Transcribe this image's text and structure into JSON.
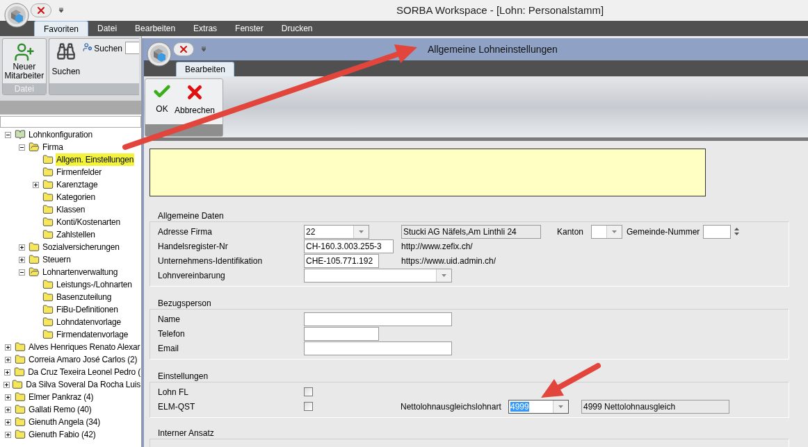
{
  "window": {
    "title": "SORBA Workspace - [Lohn: Personalstamm]"
  },
  "menu_tabs": [
    {
      "label": "Favoriten",
      "selected": true
    },
    {
      "label": "Datei",
      "selected": false
    },
    {
      "label": "Bearbeiten",
      "selected": false
    },
    {
      "label": "Extras",
      "selected": false
    },
    {
      "label": "Fenster",
      "selected": false
    },
    {
      "label": "Drucken",
      "selected": false
    }
  ],
  "ribbon": {
    "new_employee_button": "Neuer Mitarbeiter",
    "file_group_caption": "Datei",
    "search_button": "Suchen",
    "search_small_button": "Suchen"
  },
  "sidebar": {
    "tree": [
      {
        "label": "Lohnkonfiguration",
        "kind": "book",
        "expanded": true,
        "selected": false,
        "children": [
          {
            "label": "Firma",
            "kind": "folder",
            "expanded": true,
            "selected": false,
            "children": [
              {
                "label": "Allgem. Einstellungen",
                "kind": "folder",
                "selected": true
              },
              {
                "label": "Firmenfelder",
                "kind": "folder",
                "selected": false
              },
              {
                "label": "Karenztage",
                "kind": "folder",
                "expanded": false,
                "selected": false
              },
              {
                "label": "Kategorien",
                "kind": "folder",
                "selected": false
              },
              {
                "label": "Klassen",
                "kind": "folder",
                "selected": false
              },
              {
                "label": "Konti/Kostenarten",
                "kind": "folder",
                "selected": false
              },
              {
                "label": "Zahlstellen",
                "kind": "folder",
                "selected": false
              }
            ]
          },
          {
            "label": "Sozialversicherungen",
            "kind": "folder",
            "expanded": false,
            "selected": false
          },
          {
            "label": "Steuern",
            "kind": "folder",
            "expanded": false,
            "selected": false
          },
          {
            "label": "Lohnartenverwaltung",
            "kind": "folder",
            "expanded": true,
            "selected": false,
            "children": [
              {
                "label": "Leistungs-/Lohnarten",
                "kind": "folder",
                "selected": false
              },
              {
                "label": "Basenzuteilung",
                "kind": "folder",
                "selected": false
              },
              {
                "label": "FiBu-Definitionen",
                "kind": "folder",
                "selected": false
              },
              {
                "label": "Lohndatenvorlage",
                "kind": "folder",
                "selected": false
              },
              {
                "label": "Firmendatenvorlage",
                "kind": "folder",
                "selected": false
              }
            ]
          }
        ]
      },
      {
        "label": "Alves Henriques Renato Alexar",
        "kind": "folder",
        "expanded": false,
        "selected": false
      },
      {
        "label": "Correia Amaro José Carlos (2)",
        "kind": "folder",
        "expanded": false,
        "selected": false
      },
      {
        "label": "Da Cruz Texeira Leonel Pedro (",
        "kind": "folder",
        "expanded": false,
        "selected": false
      },
      {
        "label": "Da Silva Soveral Da Rocha Luis",
        "kind": "folder",
        "expanded": false,
        "selected": false
      },
      {
        "label": "Elmer Pankraz (4)",
        "kind": "folder",
        "expanded": false,
        "selected": false
      },
      {
        "label": "Gallati Remo (40)",
        "kind": "folder",
        "expanded": false,
        "selected": false
      },
      {
        "label": "Gienuth Angela (34)",
        "kind": "folder",
        "expanded": false,
        "selected": false
      },
      {
        "label": "Gienuth Fabio (42)",
        "kind": "folder",
        "expanded": false,
        "selected": false
      }
    ]
  },
  "dialog": {
    "title": "Allgemeine Lohneinstellungen",
    "tabs": [
      {
        "label": "Bearbeiten",
        "selected": true
      }
    ],
    "buttons": [
      {
        "label": "OK",
        "kind": "ok"
      },
      {
        "label": "Abbrechen",
        "kind": "cancel"
      }
    ],
    "general": {
      "title": "Allgemeine Daten",
      "address_label": "Adresse Firma",
      "address_value": "22",
      "address_text": "Stucki AG Näfels,Am Linthli 24",
      "canton_label": "Kanton",
      "municipality_label": "Gemeinde-Nummer",
      "register_label": "Handelsregister-Nr",
      "register_value": "CH-160.3.003.255-3",
      "register_link": "http://www.zefix.ch/",
      "uid_label": "Unternehmens-Identifikation",
      "uid_value": "CHE-105.771.192",
      "uid_link": "https://www.uid.admin.ch/",
      "agreement_label": "Lohnvereinbarung"
    },
    "contact": {
      "title": "Bezugsperson",
      "fields": [
        {
          "label": "Name",
          "kind": "long"
        },
        {
          "label": "Telefon",
          "kind": "short"
        },
        {
          "label": "Email",
          "kind": "long"
        }
      ]
    },
    "settings": {
      "title": "Einstellungen",
      "checkboxes": [
        {
          "label": "Lohn FL",
          "checked": false
        },
        {
          "label": "ELM-QST",
          "checked": false
        }
      ],
      "net_label": "Nettolohnausgleichslohnart",
      "net_value": "4999",
      "net_value_selected": true,
      "net_text": "4999 Nettolohnausgleich"
    },
    "internal": {
      "title": "Interner Ansatz"
    }
  }
}
